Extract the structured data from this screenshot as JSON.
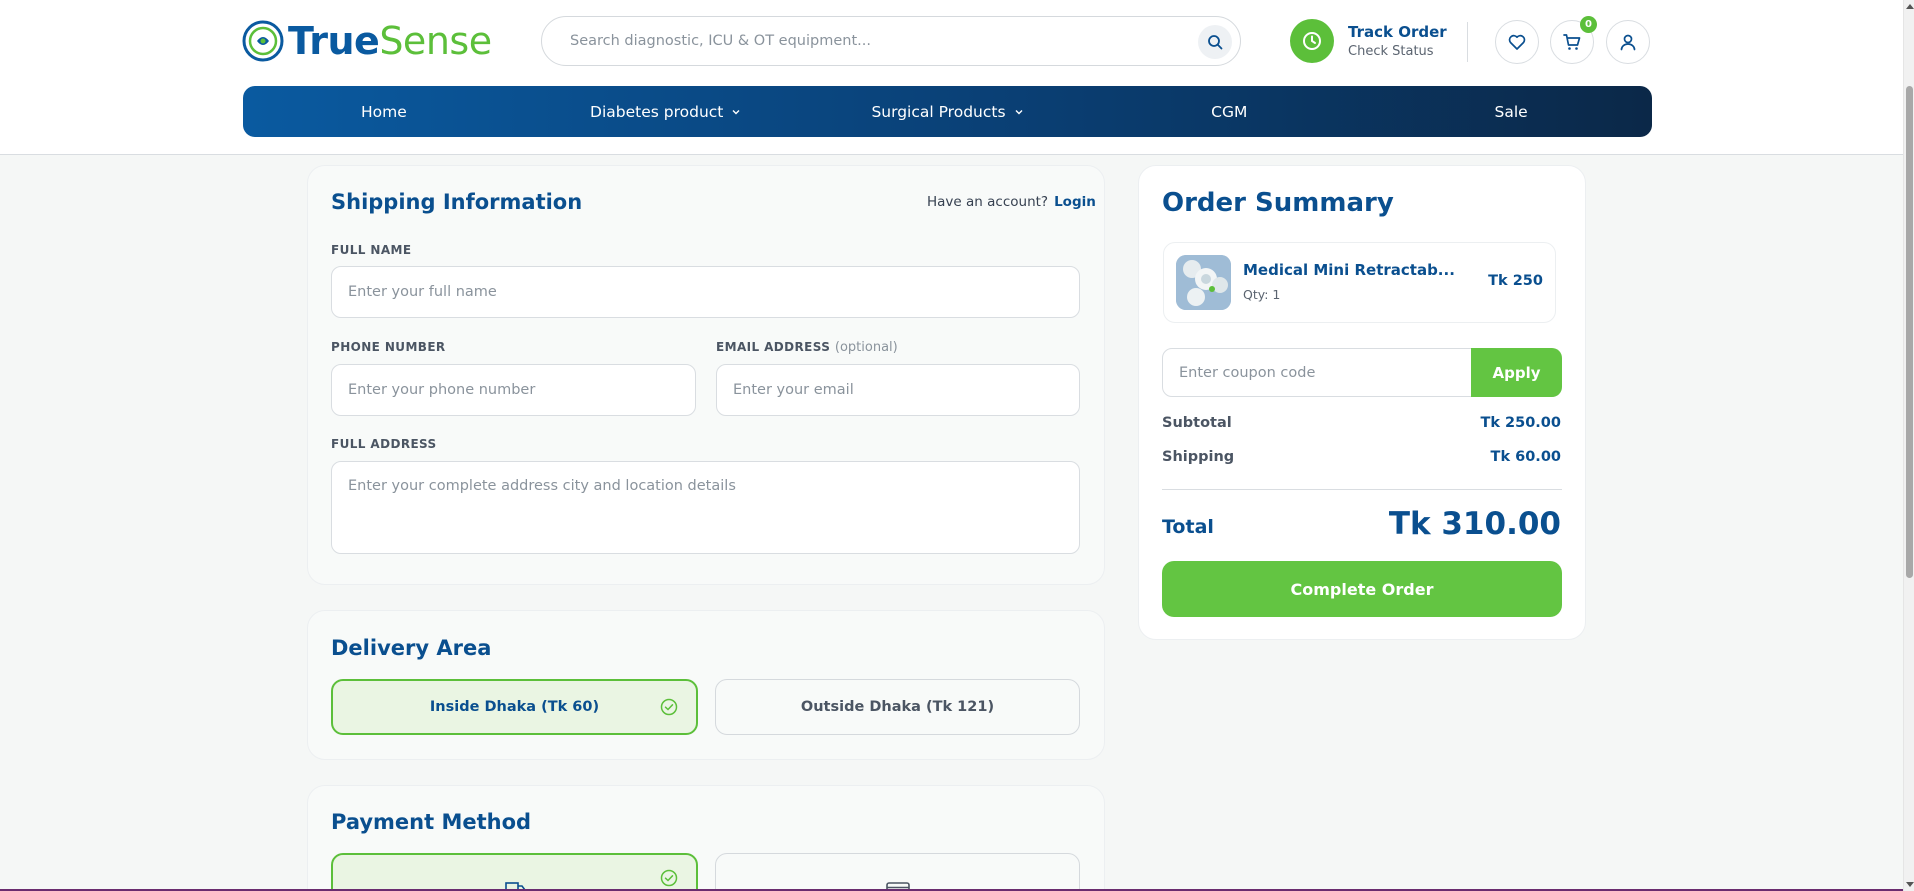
{
  "brand": {
    "name_part1": "True",
    "name_part2": "Sense",
    "primary_color": "#0a5aa0",
    "accent_color": "#5cbf3a"
  },
  "search": {
    "placeholder": "Search diagnostic, ICU & OT equipment..."
  },
  "track_order": {
    "title": "Track Order",
    "subtitle": "Check Status"
  },
  "cart": {
    "count": "0"
  },
  "nav": {
    "items": [
      {
        "label": "Home"
      },
      {
        "label": "Diabetes product"
      },
      {
        "label": "Surgical Products"
      },
      {
        "label": "CGM"
      },
      {
        "label": "Sale"
      }
    ]
  },
  "shipping": {
    "title": "Shipping Information",
    "account_prompt": "Have an account?",
    "login_label": "Login",
    "full_name": {
      "label": "FULL NAME",
      "placeholder": "Enter your full name"
    },
    "phone": {
      "label": "PHONE NUMBER",
      "placeholder": "Enter your phone number"
    },
    "email": {
      "label": "EMAIL ADDRESS",
      "optional": "(optional)",
      "placeholder": "Enter your email"
    },
    "address": {
      "label": "FULL ADDRESS",
      "placeholder": "Enter your complete address city and location details"
    }
  },
  "delivery": {
    "title": "Delivery Area",
    "options": [
      {
        "label": "Inside Dhaka (Tk 60)",
        "selected": true
      },
      {
        "label": "Outside Dhaka (Tk 121)",
        "selected": false
      }
    ]
  },
  "payment": {
    "title": "Payment Method"
  },
  "summary": {
    "title": "Order Summary",
    "item": {
      "name": "Medical Mini Retractab...",
      "qty": "Qty: 1",
      "price": "Tk 250"
    },
    "coupon": {
      "placeholder": "Enter coupon code",
      "apply_label": "Apply"
    },
    "subtotal": {
      "label": "Subtotal",
      "value": "Tk 250.00"
    },
    "shipping": {
      "label": "Shipping",
      "value": "Tk 60.00"
    },
    "total": {
      "label": "Total",
      "value": "Tk 310.00"
    },
    "complete_label": "Complete Order"
  }
}
